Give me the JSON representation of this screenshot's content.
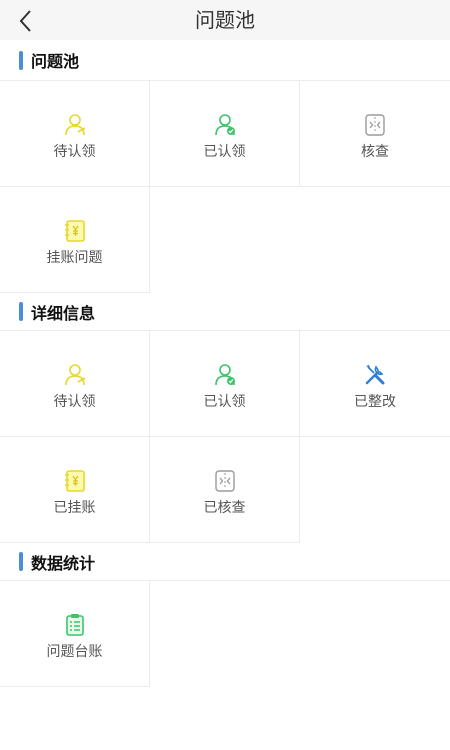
{
  "header": {
    "title": "问题池"
  },
  "sections": [
    {
      "title": "问题池",
      "items": [
        {
          "label": "待认领",
          "icon": "person-pending-icon",
          "color": "#e4d92a"
        },
        {
          "label": "已认领",
          "icon": "person-claimed-icon",
          "color": "#3cc46a"
        },
        {
          "label": "核查",
          "icon": "verify-icon",
          "color": "#9a9a9a"
        },
        {
          "label": "挂账问题",
          "icon": "ledger-icon",
          "color": "#e4d92a"
        }
      ]
    },
    {
      "title": "详细信息",
      "items": [
        {
          "label": "待认领",
          "icon": "person-pending-icon",
          "color": "#e4d92a"
        },
        {
          "label": "已认领",
          "icon": "person-claimed-icon",
          "color": "#3cc46a"
        },
        {
          "label": "已整改",
          "icon": "tools-icon",
          "color": "#2d7fd3"
        },
        {
          "label": "已挂账",
          "icon": "ledger-icon",
          "color": "#e4d92a"
        },
        {
          "label": "已核查",
          "icon": "verify-icon",
          "color": "#9a9a9a"
        }
      ]
    },
    {
      "title": "数据统计",
      "items": [
        {
          "label": "问题台账",
          "icon": "clipboard-icon",
          "color": "#3cc46a"
        }
      ]
    }
  ]
}
